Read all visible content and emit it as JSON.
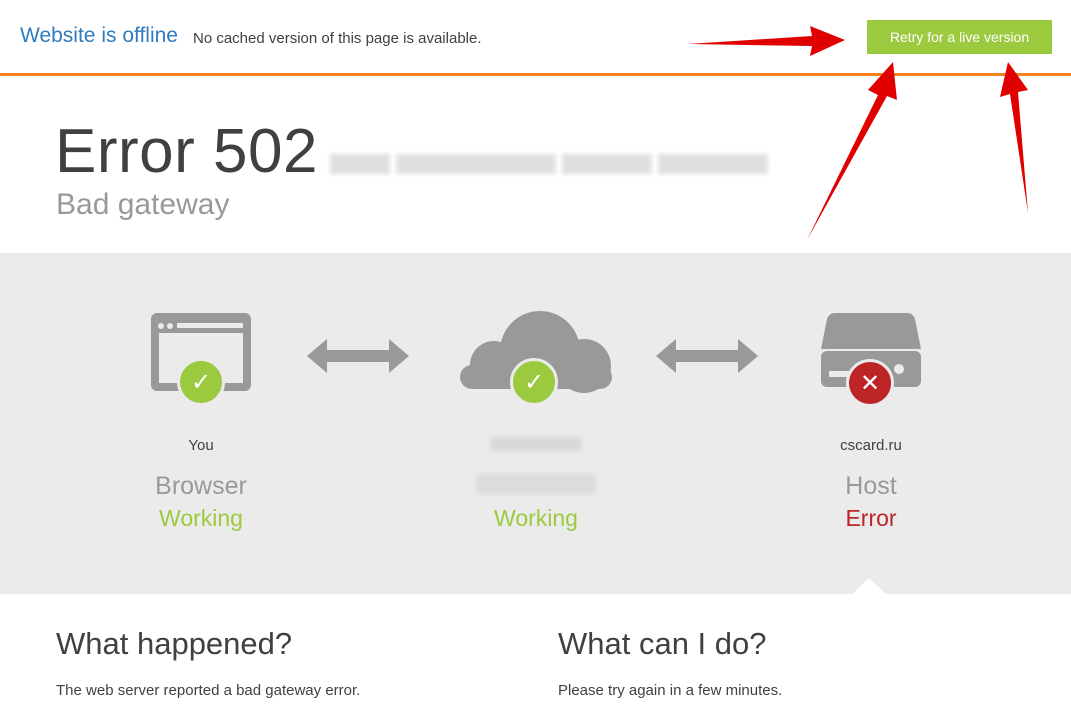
{
  "topbar": {
    "title": "Website is offline",
    "subtitle": "No cached version of this page is available.",
    "retry_label": "Retry for a live version",
    "accent": "#f6821f",
    "button_color": "#9bca3e"
  },
  "hero": {
    "code": "Error 502",
    "subtitle": "Bad gateway"
  },
  "nodes": [
    {
      "where": "You",
      "kind": "Browser",
      "state": "Working",
      "icon": "browser-window-icon",
      "badge": "check-icon"
    },
    {
      "where": "",
      "kind": "",
      "state": "Working",
      "icon": "cloud-icon",
      "badge": "check-icon"
    },
    {
      "where": "cscard.ru",
      "kind": "Host",
      "state": "Error",
      "icon": "server-drive-icon",
      "badge": "cross-icon"
    }
  ],
  "bottom": {
    "happened_title": "What happened?",
    "happened_text": "The web server reported a bad gateway error.",
    "cando_title": "What can I do?",
    "cando_text": "Please try again in a few minutes."
  },
  "colors": {
    "working": "#9bca3e",
    "error": "#bd2426",
    "link": "#2f7bbf",
    "annotation": "#e00000"
  }
}
